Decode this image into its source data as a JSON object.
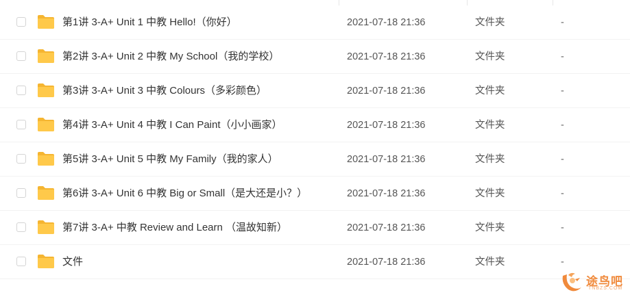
{
  "colors": {
    "folder": "#ffc94a",
    "folder_dark": "#f5b531",
    "watermark": "#f08a3c"
  },
  "rows": [
    {
      "name": "第1讲 3-A+ Unit 1 中教 Hello!（你好）",
      "date": "2021-07-18 21:36",
      "type": "文件夹",
      "size": "-",
      "icon": "folder-icon"
    },
    {
      "name": "第2讲 3-A+ Unit 2 中教 My School（我的学校）",
      "date": "2021-07-18 21:36",
      "type": "文件夹",
      "size": "-",
      "icon": "folder-icon"
    },
    {
      "name": "第3讲 3-A+ Unit 3 中教 Colours（多彩颜色）",
      "date": "2021-07-18 21:36",
      "type": "文件夹",
      "size": "-",
      "icon": "folder-icon"
    },
    {
      "name": "第4讲 3-A+ Unit 4 中教 I Can Paint（小小画家）",
      "date": "2021-07-18 21:36",
      "type": "文件夹",
      "size": "-",
      "icon": "folder-icon"
    },
    {
      "name": "第5讲 3-A+ Unit 5 中教 My Family（我的家人）",
      "date": "2021-07-18 21:36",
      "type": "文件夹",
      "size": "-",
      "icon": "folder-icon"
    },
    {
      "name": "第6讲 3-A+ Unit 6 中教 Big or Small（是大还是小？）",
      "date": "2021-07-18 21:36",
      "type": "文件夹",
      "size": "-",
      "icon": "folder-icon"
    },
    {
      "name": "第7讲 3-A+ 中教 Review and Learn （温故知新）",
      "date": "2021-07-18 21:36",
      "type": "文件夹",
      "size": "-",
      "icon": "folder-icon"
    },
    {
      "name": "文件",
      "date": "2021-07-18 21:36",
      "type": "文件夹",
      "size": "-",
      "icon": "folder-icon"
    }
  ],
  "watermark": {
    "text": "途鸟吧",
    "sub": "TNBZS.COM",
    "icon": "bird-logo-icon"
  }
}
